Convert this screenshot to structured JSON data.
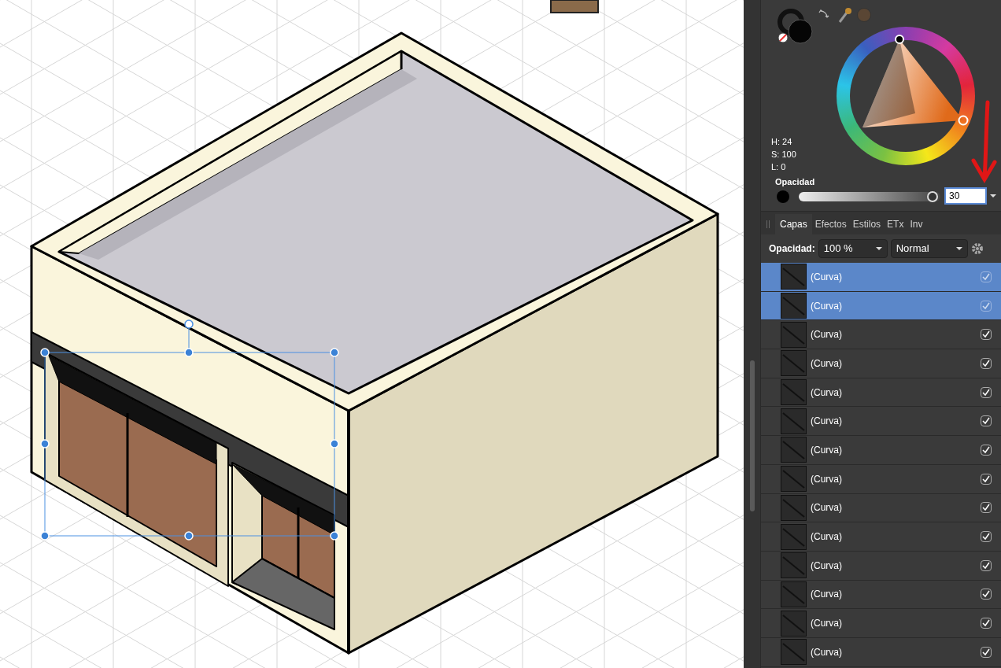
{
  "color_panel": {
    "hsl": [
      "H: 24",
      "S: 100",
      "L: 0"
    ],
    "opacity_label": "Opacidad",
    "opacity_slider": {
      "level": 0.98
    },
    "opacity_value": "30"
  },
  "tabs": [
    {
      "label": "Capas",
      "selected": true
    },
    {
      "label": "Efectos",
      "selected": false
    },
    {
      "label": "Estilos",
      "selected": false
    },
    {
      "label": "ETx",
      "selected": false
    },
    {
      "label": "Inv",
      "selected": false
    }
  ],
  "layer_toolbar": {
    "opacity_label": "Opacidad:",
    "opacity_value": "100 %",
    "blend_mode": "Normal"
  },
  "layers": [
    {
      "name": "(Curva)",
      "selected": true,
      "checked": true
    },
    {
      "name": "(Curva)",
      "selected": true,
      "checked": true
    },
    {
      "name": "(Curva)",
      "selected": false,
      "checked": true
    },
    {
      "name": "(Curva)",
      "selected": false,
      "checked": true
    },
    {
      "name": "(Curva)",
      "selected": false,
      "checked": true
    },
    {
      "name": "(Curva)",
      "selected": false,
      "checked": true
    },
    {
      "name": "(Curva)",
      "selected": false,
      "checked": true
    },
    {
      "name": "(Curva)",
      "selected": false,
      "checked": true
    },
    {
      "name": "(Curva)",
      "selected": false,
      "checked": true
    },
    {
      "name": "(Curva)",
      "selected": false,
      "checked": true
    },
    {
      "name": "(Curva)",
      "selected": false,
      "checked": true
    },
    {
      "name": "(Curva)",
      "selected": false,
      "checked": true
    },
    {
      "name": "(Curva)",
      "selected": false,
      "checked": true
    },
    {
      "name": "(Curva)",
      "selected": false,
      "checked": true
    }
  ]
}
